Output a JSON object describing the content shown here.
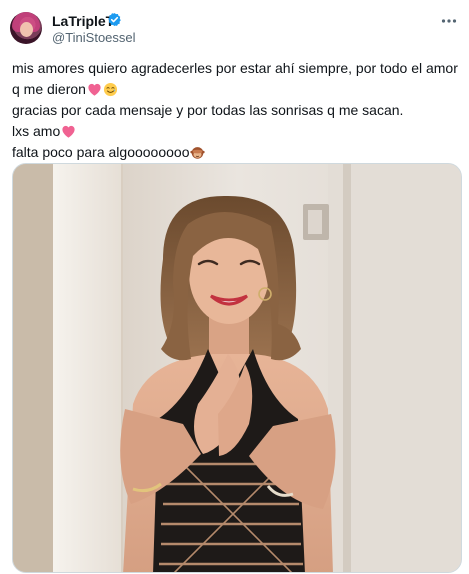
{
  "author": {
    "display_name": "LaTripleT",
    "handle": "@TiniStoessel",
    "verified": true,
    "avatar_icon": "profile-photo"
  },
  "tweet": {
    "line1": "mis amores quiero agradecerles por estar ahí siempre, por todo el amor",
    "line2": "q me dieron",
    "line3": "gracias por cada mensaje y por todas las sonrisas q me sacan.",
    "line4": "lxs amo",
    "line5": "falta poco para algoooooooo"
  },
  "icons": {
    "verified": "verified-badge-icon",
    "more": "more-options-icon",
    "heart": "pink-heart-emoji",
    "smile_tear": "smiling-face-with-tear-emoji",
    "monkey": "see-no-evil-monkey-emoji"
  },
  "colors": {
    "verified_blue": "#1d9bf0",
    "secondary_text": "#536471",
    "heart_pink": "#f06292"
  }
}
